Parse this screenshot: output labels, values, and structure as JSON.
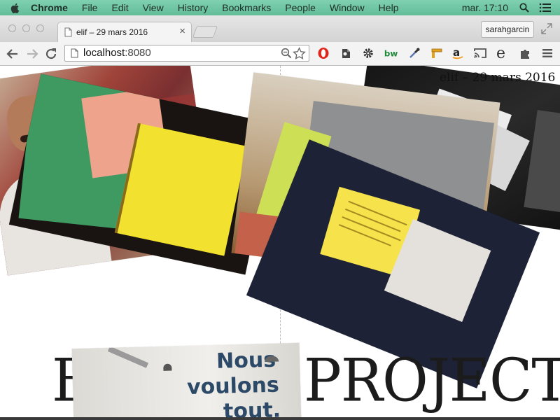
{
  "menubar": {
    "items": [
      "Chrome",
      "File",
      "Edit",
      "View",
      "History",
      "Bookmarks",
      "People",
      "Window",
      "Help"
    ],
    "clock": "mar. 17:10"
  },
  "tabs": [
    {
      "title": "elif – 29 mars 2016"
    }
  ],
  "profile": {
    "name": "sarahgarcin"
  },
  "toolbar": {
    "url_host": "localhost",
    "url_port": ":8080"
  },
  "extensions": [
    "opera-icon",
    "evernote-icon",
    "gear-icon",
    "bw-icon",
    "eyedropper-icon",
    "ruler-icon",
    "amazon-icon",
    "cast-icon",
    "e-icon",
    "puzzle-icon",
    "menu-icon"
  ],
  "page": {
    "title_fragment": "elif – 29 mars 2016",
    "heading_left": "B",
    "heading_right": "PROJECTS",
    "sign_lines": [
      "Nous",
      "voulons",
      "tout."
    ]
  },
  "colors": {
    "menubar": "#6fc7a5",
    "paper_yellow": "#f2e12e",
    "paper_pink": "#eea38d",
    "paper_green": "#3f9a62",
    "cloth_navy": "#1d2236"
  }
}
